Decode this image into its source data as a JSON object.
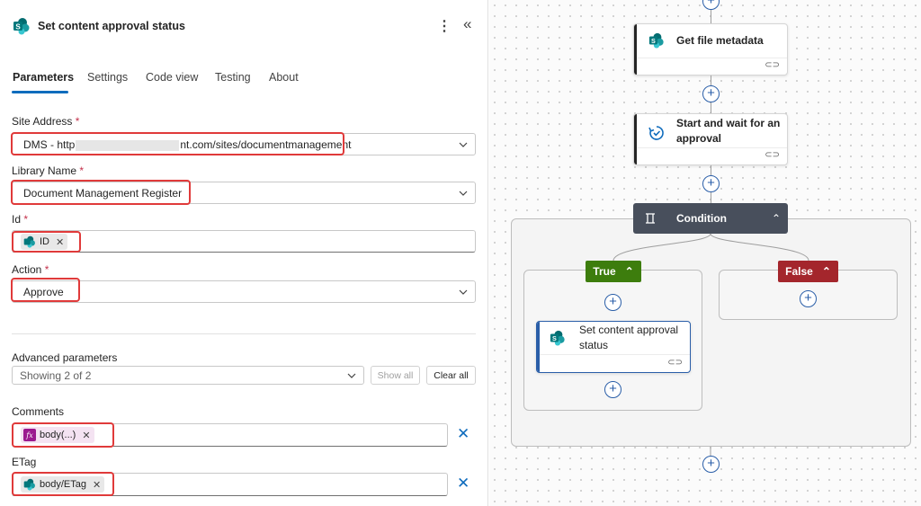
{
  "panel": {
    "title": "Set content approval status",
    "menu_glyph": "⋮",
    "collapse_glyph": "«",
    "tabs": [
      {
        "label": "Parameters"
      },
      {
        "label": "Settings"
      },
      {
        "label": "Code view"
      },
      {
        "label": "Testing"
      },
      {
        "label": "About"
      }
    ],
    "fields": {
      "site_address": {
        "label": "Site Address",
        "value_prefix": "DMS - http",
        "value_suffix": "nt.com/sites/documentmanagement"
      },
      "library_name": {
        "label": "Library Name",
        "value": "Document Management Register"
      },
      "id": {
        "label": "Id",
        "token": "ID"
      },
      "action": {
        "label": "Action",
        "value": "Approve"
      }
    },
    "required_mark": "*",
    "advanced": {
      "label": "Advanced parameters",
      "selected": "Showing 2 of 2",
      "show_all": "Show all",
      "clear_all": "Clear all"
    },
    "comments": {
      "label": "Comments",
      "token": "body(...)",
      "fx_glyph": "fx"
    },
    "etag": {
      "label": "ETag",
      "token": "body/ETag"
    },
    "token_close": "✕",
    "remove_glyph": "✕"
  },
  "canvas": {
    "nodes": {
      "get_file_metadata": "Get file metadata",
      "start_approval": "Start and wait for an approval",
      "condition": "Condition",
      "set_status": "Set content approval status"
    },
    "branches": {
      "true_label": "True",
      "false_label": "False"
    },
    "plus_glyph": "+",
    "link_glyph": "⊂⊃",
    "caret_glyph": "⌃"
  },
  "colors": {
    "accent_blue": "#0f6cbd",
    "highlight_red": "#e03a3a",
    "true_green": "#3d7d0d",
    "false_red": "#a4262c",
    "condition_dark": "#484f5c",
    "sharepoint_teal": "#038387"
  }
}
